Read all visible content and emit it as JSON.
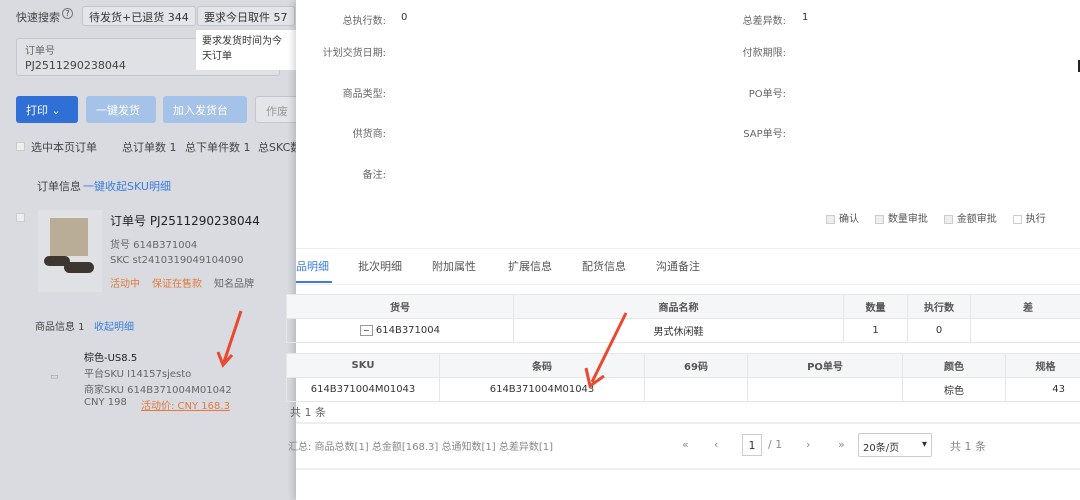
{
  "left": {
    "quick_search_label": "快速搜索",
    "chips": [
      "待发货+已退货 344",
      "要求今日取件 57"
    ],
    "tooltip": "要求发货时间为今天订单",
    "order_field": {
      "label": "订单号",
      "value": "PJ2511290238044"
    },
    "buttons": {
      "print": "打印",
      "ship": "一键发货",
      "add": "加入发货台",
      "void": "作废"
    },
    "select_page": "选中本页订单",
    "stats": [
      "总订单数 1",
      "总下单件数 1",
      "总SKC数"
    ],
    "order_info": "订单信息",
    "collapse_sku": "一键收起SKU明细",
    "order": {
      "order_no": "订单号 PJ2511290238044",
      "item_no": "货号 614B371004",
      "skc": "SKC st2410319049104090",
      "tags": [
        "活动中",
        "保证在售款",
        "知名品牌"
      ]
    },
    "goods_info": "商品信息 1",
    "collapse_detail": "收起明细",
    "sku": {
      "variant": "棕色-US8.5",
      "platform_sku": "平台SKU I14157sjesto",
      "merchant_sku": "商家SKU 614B371004M01042",
      "price": "CNY 198",
      "promo_price": "活动价: CNY 168.3"
    }
  },
  "right": {
    "fields": [
      {
        "label": "总执行数:",
        "value": "0"
      },
      {
        "label": "总差异数:",
        "value": "1"
      },
      {
        "label": "计划交货日期:",
        "value": ""
      },
      {
        "label": "付款期限:",
        "value": ""
      },
      {
        "label": "商品类型:",
        "value": ""
      },
      {
        "label": "PO单号:",
        "value": ""
      },
      {
        "label": "供货商:",
        "value": ""
      },
      {
        "label": "SAP单号:",
        "value": ""
      },
      {
        "label": "备注:",
        "value": ""
      }
    ],
    "checks": [
      "确认",
      "数量审批",
      "金额审批",
      "执行"
    ],
    "tabs": [
      "品明细",
      "批次明细",
      "附加属性",
      "扩展信息",
      "配货信息",
      "沟通备注"
    ],
    "table1": {
      "headers": [
        "货号",
        "商品名称",
        "数量",
        "执行数",
        "差"
      ],
      "row": [
        "614B371004",
        "男式休闲鞋",
        "1",
        "0",
        ""
      ]
    },
    "table2": {
      "headers": [
        "SKU",
        "条码",
        "69码",
        "PO单号",
        "颜色",
        "规格"
      ],
      "row": [
        "614B371004M01043",
        "614B371004M01043",
        "",
        "",
        "棕色",
        "43"
      ]
    },
    "total_rows": "共 1 条",
    "summary": "汇总: 商品总数[1]  总金额[168.3]  总通知数[1]  总差异数[1]",
    "pager": {
      "page": "1",
      "of": "/ 1",
      "size": "20条/页",
      "total": "共 1 条"
    }
  }
}
